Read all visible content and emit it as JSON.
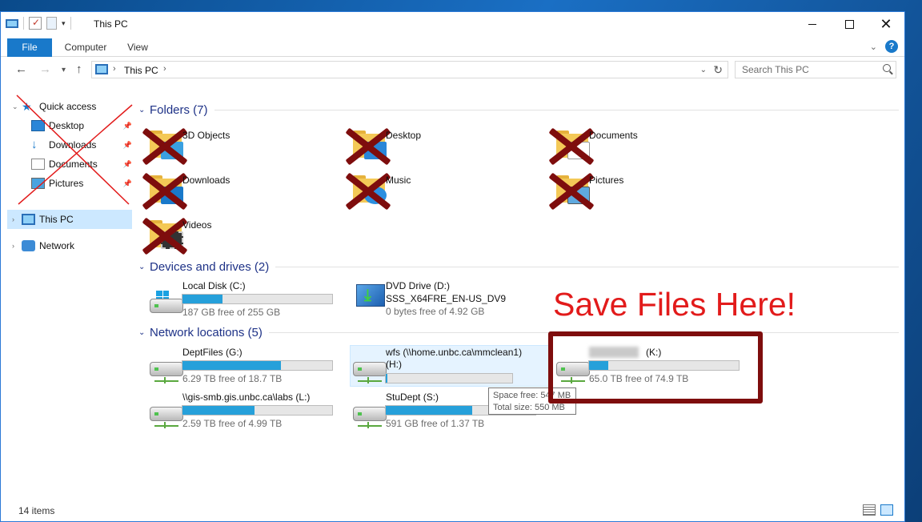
{
  "window": {
    "title": "This PC"
  },
  "ribbon": {
    "tabs": [
      "File",
      "Computer",
      "View"
    ]
  },
  "address": {
    "location": "This PC"
  },
  "search": {
    "placeholder": "Search This PC"
  },
  "nav": {
    "quick_access": "Quick access",
    "items": [
      "Desktop",
      "Downloads",
      "Documents",
      "Pictures"
    ],
    "this_pc": "This PC",
    "network": "Network"
  },
  "folders": {
    "header": "Folders (7)",
    "items": [
      "3D Objects",
      "Desktop",
      "Documents",
      "Downloads",
      "Music",
      "Pictures",
      "Videos"
    ]
  },
  "devices": {
    "header": "Devices and drives (2)",
    "local": {
      "name": "Local Disk (C:)",
      "free": "187 GB free of 255 GB",
      "used_fraction": 0.27
    },
    "dvd": {
      "name": "DVD Drive (D:)",
      "label": "SSS_X64FRE_EN-US_DV9",
      "free": "0 bytes free of 4.92 GB"
    }
  },
  "network": {
    "header": "Network locations (5)",
    "drives": [
      {
        "name": "DeptFiles (G:)",
        "free": "6.29 TB free of 18.7 TB",
        "used_fraction": 0.66
      },
      {
        "name": "wfs (\\\\home.unbc.ca\\mmclean1) (H:)",
        "free": "",
        "used_fraction": 0.01
      },
      {
        "name": "(K:)",
        "free": "65.0 TB free of 74.9 TB",
        "used_fraction": 0.13
      },
      {
        "name": "\\\\gis-smb.gis.unbc.ca\\labs (L:)",
        "free": "2.59 TB free of 4.99 TB",
        "used_fraction": 0.48
      },
      {
        "name": "StuDept (S:)",
        "free": "591 GB free of 1.37 TB",
        "used_fraction": 0.58
      }
    ]
  },
  "tooltip": {
    "line1": "Space free: 547 MB",
    "line2": "Total size: 550 MB"
  },
  "annotation": {
    "text": "Save Files Here!",
    "color": "#e21b1b",
    "mark_color": "#7e0d0d"
  },
  "status": {
    "count": "14 items"
  },
  "colors": {
    "accent": "#1979ca",
    "selection": "#cce8ff",
    "bar_fill": "#26a0da",
    "group_header": "#1e3287"
  }
}
